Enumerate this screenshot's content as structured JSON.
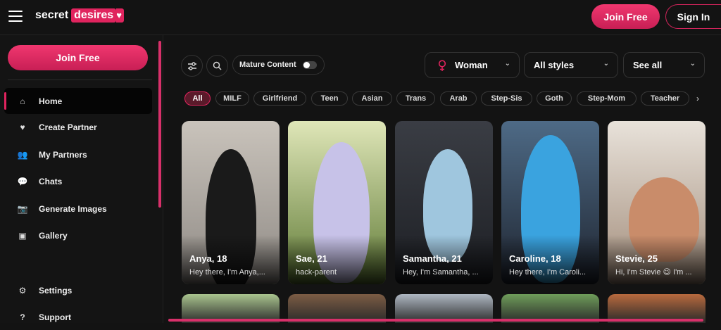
{
  "brand": {
    "word1": "secret",
    "word2": "desires",
    "heart": "♥"
  },
  "header": {
    "join_label": "Join Free",
    "signin_label": "Sign In"
  },
  "sidebar": {
    "join_label": "Join Free",
    "items": [
      {
        "label": "Home",
        "icon": "home-icon",
        "glyph": "⌂"
      },
      {
        "label": "Create Partner",
        "icon": "shield-heart-icon",
        "glyph": "♥"
      },
      {
        "label": "My Partners",
        "icon": "people-icon",
        "glyph": "👥"
      },
      {
        "label": "Chats",
        "icon": "chat-icon",
        "glyph": "💬"
      },
      {
        "label": "Generate Images",
        "icon": "camera-icon",
        "glyph": "📷"
      },
      {
        "label": "Gallery",
        "icon": "gallery-icon",
        "glyph": "▣"
      },
      {
        "label": "Settings",
        "icon": "gear-icon",
        "glyph": "⚙"
      },
      {
        "label": "Support",
        "icon": "help-icon",
        "glyph": "?"
      }
    ]
  },
  "filters": {
    "mature_label": "Mature Content",
    "gender": "Woman",
    "style": "All styles",
    "see_all": "See all"
  },
  "chips": [
    "All",
    "MILF",
    "Girlfriend",
    "Teen",
    "Asian",
    "Trans",
    "Arab",
    "Step-Sis",
    "Goth",
    "Step-Mom",
    "Teacher"
  ],
  "cards": [
    {
      "name": "Anya, 18",
      "desc": "Hey there, I'm Anya,...",
      "bg1": "#c9c3bb",
      "bg2": "#8f8a85",
      "fig": "#1a1a1a"
    },
    {
      "name": "Sae, 21",
      "desc": "hack-parent",
      "bg1": "#dfe6b8",
      "bg2": "#5f7a35",
      "fig": "#c7c2e8"
    },
    {
      "name": "Samantha, 21",
      "desc": "Hey, I'm Samantha, ...",
      "bg1": "#3a3d44",
      "bg2": "#1d1f24",
      "fig": "#9fc6de"
    },
    {
      "name": "Caroline, 18",
      "desc": "Hey there, I'm Caroli...",
      "bg1": "#4e6a86",
      "bg2": "#1f2530",
      "fig": "#3aa3df"
    },
    {
      "name": "Stevie, 25",
      "desc": "Hi, I'm Stevie 😉 I'm ...",
      "bg1": "#e8e2da",
      "bg2": "#a28c7a",
      "fig": "#c98c6a"
    }
  ],
  "row2_colors": [
    "#a9c48e",
    "#7c5c44",
    "#aeb7c2",
    "#6f9d5a",
    "#b86a3e"
  ]
}
